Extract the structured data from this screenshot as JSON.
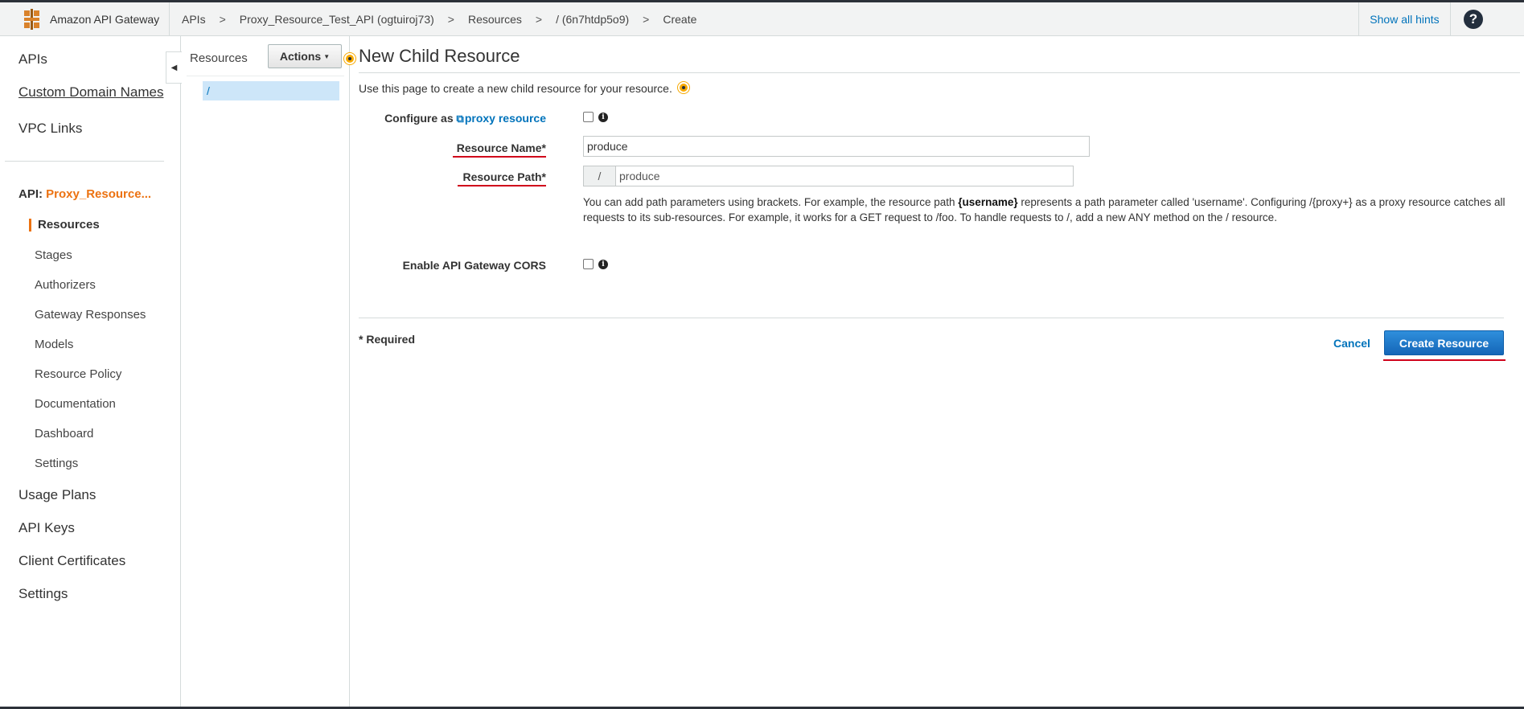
{
  "topbar": {
    "brand": "Amazon API Gateway",
    "breadcrumbs": [
      "APIs",
      "Proxy_Resource_Test_API (ogtuiroj73)",
      "Resources",
      "/ (6n7htdp5o9)",
      "Create"
    ],
    "separator": ">",
    "show_hints": "Show all hints",
    "help_icon_text": "?"
  },
  "leftnav": {
    "top_items": [
      "APIs",
      "Custom Domain Names",
      "VPC Links"
    ],
    "api_prefix": "API:",
    "api_name": "Proxy_Resource...",
    "active_item": "Resources",
    "api_items": [
      "Stages",
      "Authorizers",
      "Gateway Responses",
      "Models",
      "Resource Policy",
      "Documentation",
      "Dashboard",
      "Settings"
    ],
    "bottom_items": [
      "Usage Plans",
      "API Keys",
      "Client Certificates",
      "Settings"
    ],
    "collapse_icon": "caret-left-icon"
  },
  "tree": {
    "title": "Resources",
    "actions_label": "Actions",
    "root_item": "/"
  },
  "main": {
    "title": "New Child Resource",
    "intro": "Use this page to create a new child resource for your resource.",
    "configure_as": "Configure as",
    "proxy_link": "proxy resource",
    "resource_name_label": "Resource Name",
    "resource_name_value": "produce",
    "resource_path_label": "Resource Path",
    "resource_path_prefix": "/",
    "resource_path_value": "produce",
    "asterisk": "*",
    "help_1": "You can add path parameters using brackets. For example, the resource path",
    "help_bold": "{username}",
    "help_2": "represents a path parameter called 'username'. Configuring /{proxy+} as a proxy resource catches all requests to its sub-resources. For example, it works for a GET request to /foo. To handle requests to /, add a new ANY method on the / resource.",
    "cors_label": "Enable API Gateway CORS",
    "required_note": "* Required",
    "cancel": "Cancel",
    "create": "Create Resource"
  },
  "colors": {
    "accent_orange": "#ec7211",
    "link_blue": "#0073bb",
    "primary_button": "#1a73c7",
    "annotation_red": "#d0021b"
  }
}
